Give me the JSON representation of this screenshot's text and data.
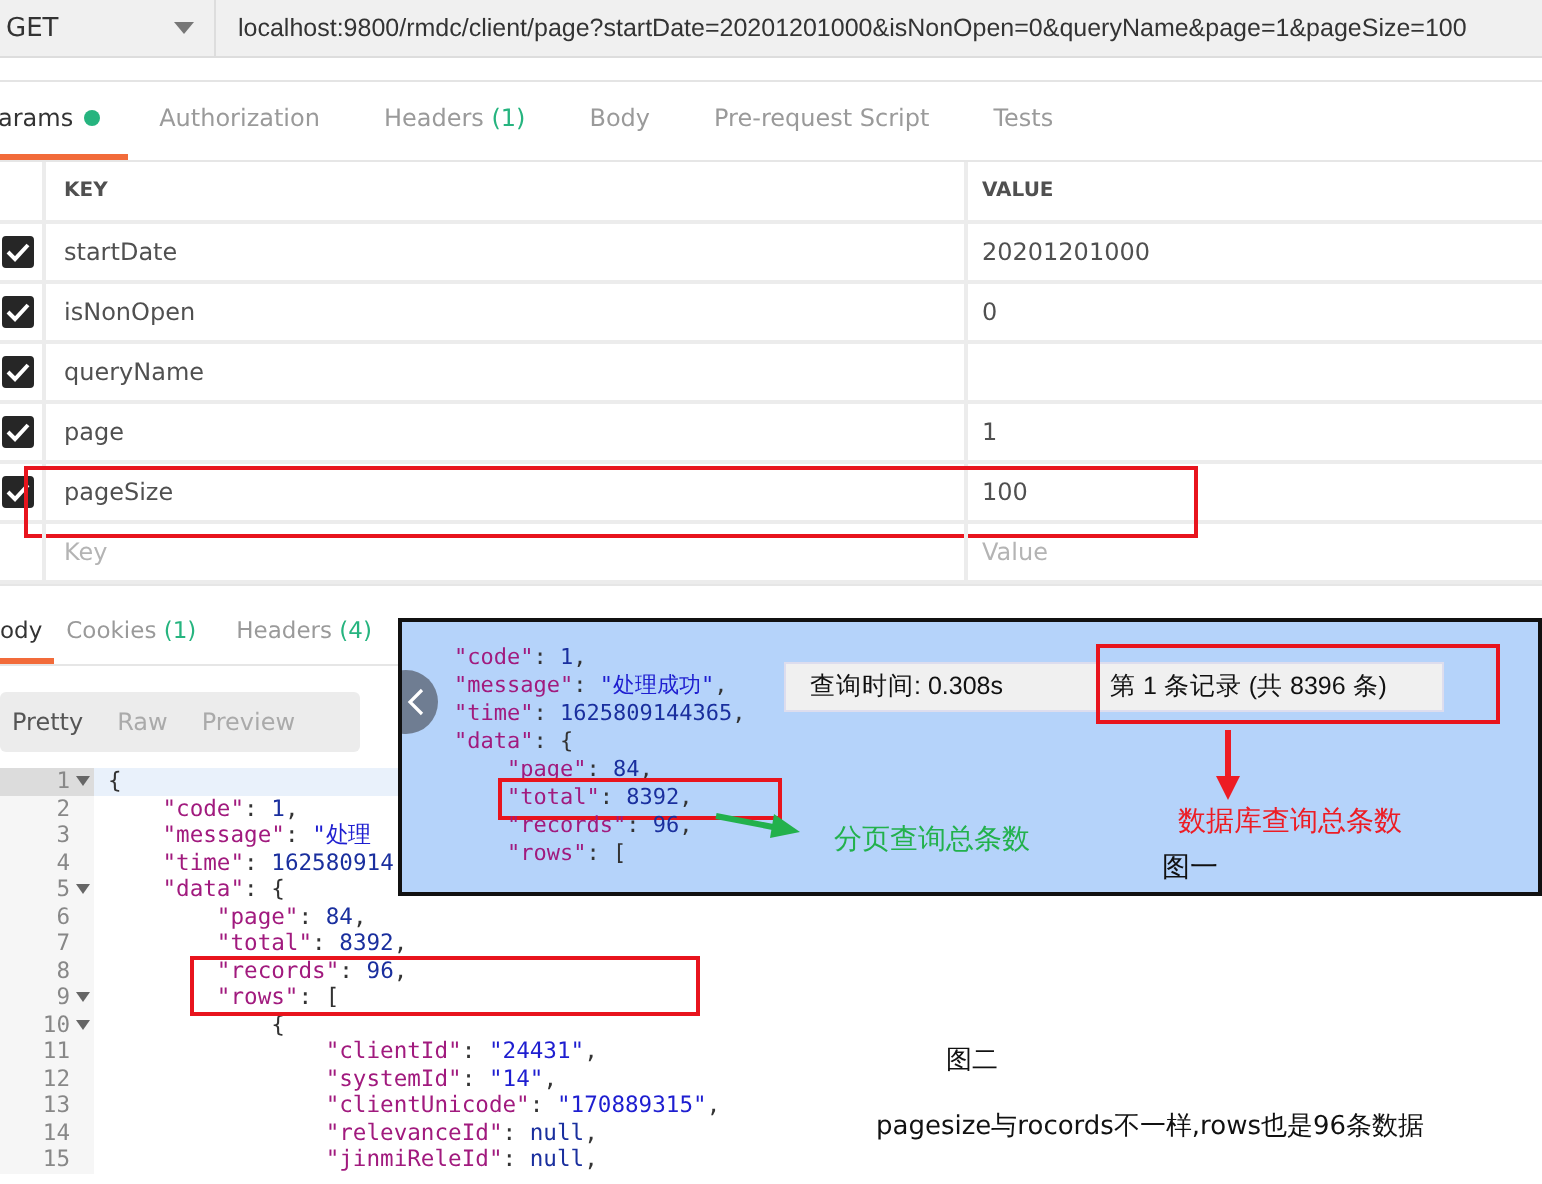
{
  "request": {
    "method": "GET",
    "url": "localhost:9800/rmdc/client/page?startDate=20201201000&isNonOpen=0&queryName&page=1&pageSize=100"
  },
  "request_tabs": [
    {
      "label": "arams",
      "dot": true,
      "selected": true
    },
    {
      "label": "Authorization",
      "selected": false
    },
    {
      "label": "Headers",
      "count": "(1)",
      "selected": false
    },
    {
      "label": "Body",
      "selected": false
    },
    {
      "label": "Pre-request Script",
      "selected": false
    },
    {
      "label": "Tests",
      "selected": false
    }
  ],
  "params": {
    "columns": [
      "KEY",
      "VALUE"
    ],
    "rows": [
      {
        "key": "startDate",
        "value": "20201201000",
        "checked": true,
        "highlighted": false
      },
      {
        "key": "isNonOpen",
        "value": "0",
        "checked": true,
        "highlighted": false
      },
      {
        "key": "queryName",
        "checked": true,
        "highlighted": false
      },
      {
        "key": "page",
        "value": "1",
        "checked": true,
        "highlighted": false
      },
      {
        "key": "pageSize",
        "value": "100",
        "checked": true,
        "highlighted": true
      }
    ],
    "new_row": {
      "key_placeholder": "Key",
      "value_placeholder": "Value"
    }
  },
  "response_tabs": [
    {
      "label": "ody",
      "selected": true
    },
    {
      "label": "Cookies",
      "count": "(1)",
      "selected": false
    },
    {
      "label": "Headers",
      "count": "(4)",
      "selected": false
    }
  ],
  "view_modes": [
    {
      "label": "Pretty",
      "selected": true
    },
    {
      "label": "Raw",
      "selected": false
    },
    {
      "label": "Preview",
      "selected": false
    }
  ],
  "editor": {
    "lines": [
      {
        "number": "1",
        "text": "{",
        "foldable": true,
        "active": true,
        "highlighted": false
      },
      {
        "number": "2",
        "text": "    \"code\": 1,",
        "foldable": false,
        "active": false,
        "highlighted": false
      },
      {
        "number": "3",
        "text": "    \"message\": \"处理",
        "foldable": false,
        "active": false,
        "highlighted": false
      },
      {
        "number": "4",
        "text": "    \"time\": 162580914",
        "foldable": false,
        "active": false,
        "highlighted": false
      },
      {
        "number": "5",
        "text": "    \"data\": {",
        "foldable": true,
        "active": false,
        "highlighted": false
      },
      {
        "number": "6",
        "text": "        \"page\": 84,",
        "foldable": false,
        "active": false,
        "highlighted": false
      },
      {
        "number": "7",
        "text": "        \"total\": 8392,",
        "foldable": false,
        "active": false,
        "highlighted": false
      },
      {
        "number": "8",
        "text": "        \"records\": 96,",
        "foldable": false,
        "active": false,
        "highlighted": true
      },
      {
        "number": "9",
        "text": "        \"rows\": [",
        "foldable": true,
        "active": false,
        "highlighted": true
      },
      {
        "number": "10",
        "text": "            {",
        "foldable": true,
        "active": false,
        "highlighted": false
      },
      {
        "number": "11",
        "text": "                \"clientId\": \"24431\",",
        "foldable": false,
        "active": false,
        "highlighted": false
      },
      {
        "number": "12",
        "text": "                \"systemId\": \"14\",",
        "foldable": false,
        "active": false,
        "highlighted": false
      },
      {
        "number": "13",
        "text": "                \"clientUnicode\": \"170889315\",",
        "foldable": false,
        "active": false,
        "highlighted": false
      },
      {
        "number": "14",
        "text": "                \"relevanceId\": null,",
        "foldable": false,
        "active": false,
        "highlighted": false
      },
      {
        "number": "15",
        "text": "                \"jinmiReleId\": null,",
        "foldable": false,
        "active": false,
        "highlighted": false
      }
    ]
  },
  "inset_screenshot": {
    "code_lines": [
      {
        "text": "\"code\": 1,",
        "highlighted": false
      },
      {
        "text": "\"message\": \"处理成功\",",
        "highlighted": false
      },
      {
        "text": "\"time\": 1625809144365,",
        "highlighted": false
      },
      {
        "text": "\"data\": {",
        "highlighted": false
      },
      {
        "text": "    \"page\": 84,",
        "highlighted": false
      },
      {
        "text": "    \"total\": 8392,",
        "highlighted": true
      },
      {
        "text": "    \"records\": 96,",
        "highlighted": false
      },
      {
        "text": "    \"rows\": [",
        "highlighted": false
      }
    ],
    "status_bar": [
      {
        "text": "查询时间: 0.308s",
        "highlighted": false
      },
      {
        "text": "第 1 条记录 (共 8396 条)",
        "highlighted": true
      }
    ],
    "notes": [
      {
        "kind": "side-arrow",
        "text": "分页查询总条数",
        "color": "#22b14c"
      },
      {
        "kind": "down-arrow",
        "text": "数据库查询总条数",
        "color": "#ed1c24"
      }
    ],
    "caption": "图一"
  },
  "caption": "图二",
  "note": "pagesize与rocords不一样,rows也是96条数据"
}
